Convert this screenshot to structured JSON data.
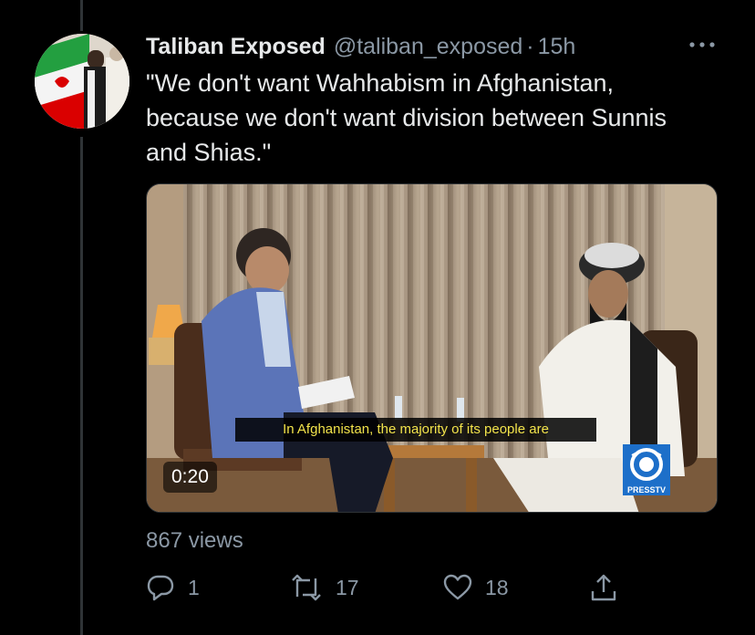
{
  "tweet": {
    "display_name": "Taliban Exposed",
    "handle": "@taliban_exposed",
    "separator": "·",
    "time": "15h",
    "text": "\"We don't want Wahhabism in Afghanistan, because we don't want division between Sunnis and Shias.\"",
    "more_icon": "more-horizontal-icon",
    "avatar_alt": "avatar with Iranian flag"
  },
  "media": {
    "subtitle": "In Afghanistan, the majority of its people are",
    "duration": "0:20",
    "logo_text": "PRESSTV"
  },
  "stats": {
    "views": "867 views"
  },
  "actions": {
    "reply_count": "1",
    "retweet_count": "17",
    "like_count": "18",
    "reply_icon": "reply-icon",
    "retweet_icon": "retweet-icon",
    "like_icon": "heart-icon",
    "share_icon": "share-icon"
  },
  "colors": {
    "background": "#000000",
    "primary_text": "#e7e9ea",
    "secondary_text": "#8b98a5",
    "subtitle_text": "#f2e34b",
    "thread_line": "#2f3336"
  }
}
